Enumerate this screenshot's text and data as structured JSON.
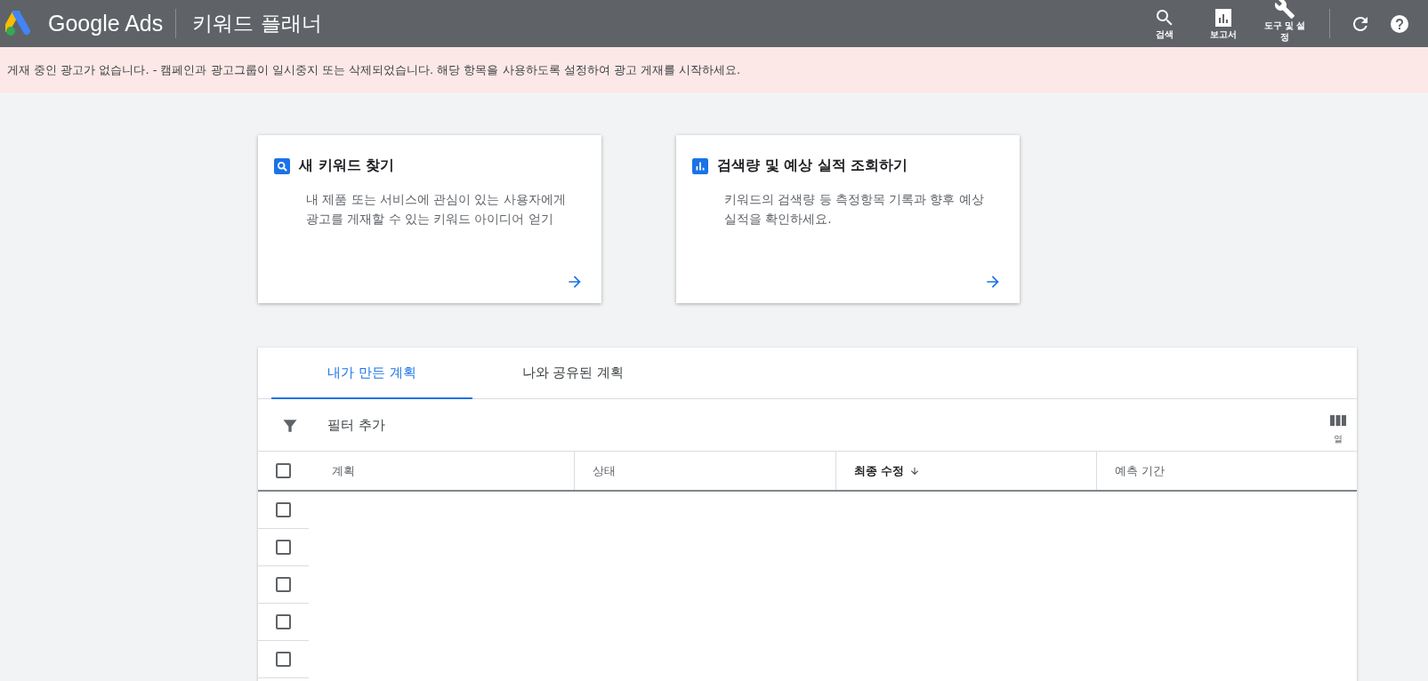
{
  "header": {
    "brand": "Google Ads",
    "title": "키워드 플래너",
    "actions": [
      {
        "kind": "search",
        "label": "검색"
      },
      {
        "kind": "reports",
        "label": "보고서"
      },
      {
        "kind": "tools",
        "label": "도구 및 설정"
      }
    ],
    "icons": [
      {
        "kind": "refresh"
      },
      {
        "kind": "help"
      }
    ]
  },
  "banner": {
    "text": "게재 중인 광고가 없습니다. - 캠페인과 광고그룹이 일시중지 또는 삭제되었습니다. 해당 항목을 사용하도록 설정하여 광고 게재를 시작하세요."
  },
  "cards": [
    {
      "kind": "search",
      "title": "새 키워드 찾기",
      "description": "내 제품 또는 서비스에 관심이 있는 사용자에게 광고를 게재할 수 있는 키워드 아이디어 얻기"
    },
    {
      "kind": "chart",
      "title": "검색량 및 예상 실적 조회하기",
      "description": "키워드의 검색량 등 측정항목 기록과 향후 예상 실적을 확인하세요."
    }
  ],
  "plans": {
    "tabs": [
      {
        "label": "내가 만든 계획",
        "selected": true
      },
      {
        "label": "나와 공유된 계획",
        "selected": false
      }
    ],
    "filter": {
      "label": "필터 추가"
    },
    "columns_button": {
      "label": "열"
    },
    "table": {
      "select_all": {
        "checked": false
      },
      "columns": [
        {
          "label": "계획",
          "sorted": false
        },
        {
          "label": "상태",
          "sorted": false
        },
        {
          "label": "최종 수정",
          "sorted": true
        },
        {
          "label": "예측 기간",
          "sorted": false
        }
      ],
      "rows": [
        {
          "checked": false
        },
        {
          "checked": false
        },
        {
          "checked": false
        },
        {
          "checked": false
        },
        {
          "checked": false
        }
      ]
    }
  }
}
